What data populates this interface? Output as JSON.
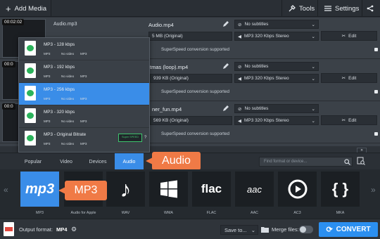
{
  "toolbar": {
    "add_media": "Add Media",
    "tools": "Tools",
    "settings": "Settings"
  },
  "files": [
    {
      "time": "00:02:02",
      "source_name": "Audio.mp3",
      "output_name": "Audio.mp4",
      "size": "5 MB (Original)",
      "subtitles": "No subtitles",
      "audio": "MP3 320 Kbps Stereo",
      "edit": "Edit",
      "note": "SuperSpeed conversion supported"
    },
    {
      "time": "00:0",
      "source_name": "",
      "output_name": "tmas (loop).mp4",
      "size": "939 KB (Original)",
      "subtitles": "No subtitles",
      "audio": "MP3 320 Kbps Stereo",
      "edit": "Edit",
      "note": "SuperSpeed conversion supported"
    },
    {
      "time": "00:0",
      "source_name": "",
      "output_name": "ner_fun.mp4",
      "size": "569 KB (Original)",
      "subtitles": "No subtitles",
      "audio": "MP3 320 Kbps Stereo",
      "edit": "Edit",
      "note": "SuperSpeed conversion supported"
    }
  ],
  "dropdown": {
    "items": [
      {
        "title": "MP3 - 128 kbps",
        "codec": "MP3",
        "video": "No video",
        "audio": "MP3",
        "selected": false
      },
      {
        "title": "MP3 - 192 kbps",
        "codec": "MP3",
        "video": "No video",
        "audio": "MP3",
        "selected": false
      },
      {
        "title": "MP3 - 256 kbps",
        "codec": "MP3",
        "video": "No video",
        "audio": "MP3",
        "selected": true
      },
      {
        "title": "MP3 - 320 kbps",
        "codec": "MP3",
        "video": "No video",
        "audio": "MP3",
        "selected": false
      },
      {
        "title": "MP3 - Original Bitrate",
        "codec": "MP3",
        "video": "No video",
        "audio": "MP3",
        "selected": false
      }
    ],
    "superspeed_badge": "Super SPEED"
  },
  "tabs": [
    {
      "label": "Popular"
    },
    {
      "label": "Video"
    },
    {
      "label": "Devices"
    },
    {
      "label": "Audio",
      "active": true
    }
  ],
  "search": {
    "placeholder": "Find format or device..."
  },
  "formats": [
    {
      "label": "MP3",
      "icon": "mp3-logo-icon",
      "selected": true
    },
    {
      "label": "Audio for Apple",
      "icon": "apple-audio-icon"
    },
    {
      "label": "WAV",
      "icon": "music-note-icon"
    },
    {
      "label": "WMA",
      "icon": "windows-logo-icon"
    },
    {
      "label": "FLAC",
      "icon": "flac-logo-icon"
    },
    {
      "label": "AAC",
      "icon": "aac-logo-icon"
    },
    {
      "label": "AC3",
      "icon": "play-circle-icon"
    },
    {
      "label": "MKA",
      "icon": "mka-logo-icon"
    }
  ],
  "callouts": {
    "audio": "Audio",
    "mp3": "MP3"
  },
  "bottom": {
    "output_format_label": "Output format:",
    "output_format_value": "MP4",
    "save_to": "Save to...",
    "merge_files": "Merge files:",
    "convert": "CONVERT"
  },
  "colors": {
    "accent": "#3a8de8",
    "callout": "#f07a46",
    "convert": "#2b8ff0"
  }
}
